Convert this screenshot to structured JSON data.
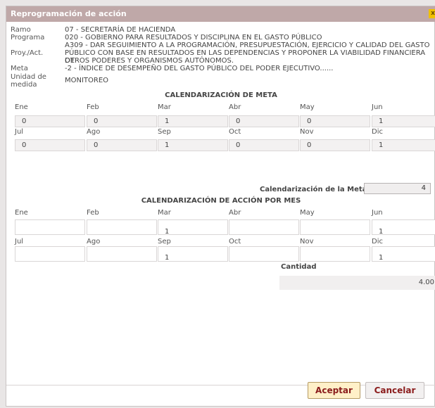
{
  "dialog": {
    "title": "Reprogramación de acción",
    "close": "x"
  },
  "info": {
    "ramo_label": "Ramo",
    "ramo_value": "07 - SECRETARÍA DE HACIENDA",
    "programa_label": "Programa",
    "programa_value": "020 - GOBIERNO PARA RESULTADOS Y DISCIPLINA EN EL GASTO PÚBLICO",
    "proy_label": "Proy./Act.",
    "proy_line1": "A309 - DAR SEGUIMIENTO A LA PROGRAMACIÓN, PRESUPUESTACIÓN, EJERCICIO Y CALIDAD DEL GASTO",
    "proy_line2": "PÚBLICO CON BASE EN RESULTADOS EN LAS DEPENDENCIAS Y PROPONER LA VIABILIDAD FINANCIERA DE",
    "proy_line3": "OTROS PODERES Y ORGANISMOS AUTÓNOMOS.",
    "meta_label": "Meta",
    "meta_value": "-2 - ÍNDICE DE DESEMPEÑO DEL GASTO PÚBLICO DEL PODER EJECUTIVO......",
    "unidad_label_1": "Unidad de",
    "unidad_label_2": "medida",
    "unidad_value": "MONITOREO"
  },
  "meta_calendar": {
    "title": "CALENDARIZACIÓN DE META",
    "months_row1": [
      "Ene",
      "Feb",
      "Mar",
      "Abr",
      "May",
      "Jun"
    ],
    "values_row1": [
      "0",
      "0",
      "1",
      "0",
      "0",
      "1"
    ],
    "months_row2": [
      "Jul",
      "Ago",
      "Sep",
      "Oct",
      "Nov",
      "Dic"
    ],
    "values_row2": [
      "0",
      "0",
      "1",
      "0",
      "0",
      "1"
    ],
    "total_label": "Calendarización de la Meta:",
    "total_value": "4"
  },
  "action_calendar": {
    "title": "CALENDARIZACIÓN DE ACCIÓN POR MES",
    "months_row1": [
      "Ene",
      "Feb",
      "Mar",
      "Abr",
      "May",
      "Jun"
    ],
    "values_row1": [
      "",
      "",
      "1",
      "",
      "",
      "1"
    ],
    "months_row2": [
      "Jul",
      "Ago",
      "Sep",
      "Oct",
      "Nov",
      "Dic"
    ],
    "values_row2": [
      "",
      "",
      "1",
      "",
      "",
      "1"
    ],
    "quantity_label": "Cantidad",
    "quantity_value": "4.00"
  },
  "buttons": {
    "accept": "Aceptar",
    "cancel": "Cancelar"
  },
  "colors": {
    "titlebar": "#bfa8a8",
    "button_text": "#8b1c1c",
    "accept_bg": "#fff0c8"
  }
}
